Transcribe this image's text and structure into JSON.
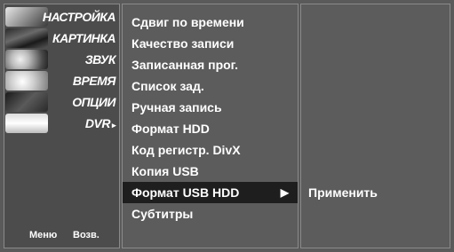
{
  "categories": [
    {
      "label": "НАСТРОЙКА",
      "icon": "antenna-icon"
    },
    {
      "label": "КАРТИНКА",
      "icon": "film-icon"
    },
    {
      "label": "ЗВУК",
      "icon": "speaker-icon"
    },
    {
      "label": "ВРЕМЯ",
      "icon": "clock-icon"
    },
    {
      "label": "ОПЦИИ",
      "icon": "special-icon"
    },
    {
      "label": "DVR",
      "icon": "disc-icon",
      "arrow": "▸"
    }
  ],
  "footer": {
    "menu": "Меню",
    "back": "Возв."
  },
  "menu_items": [
    "Сдвиг по времени",
    "Качество записи",
    "Записанная прог.",
    "Список зад.",
    "Ручная запись",
    "Формат HDD",
    "Код регистр. DivX",
    "Копия USB",
    "Формат USB HDD",
    "Субтитры"
  ],
  "selected_item_arrow": "▶",
  "submenu": {
    "apply": "Применить"
  },
  "colors": {
    "background": "#5a5a5a",
    "selected": "#1e1e1e",
    "text": "#ffffff"
  }
}
